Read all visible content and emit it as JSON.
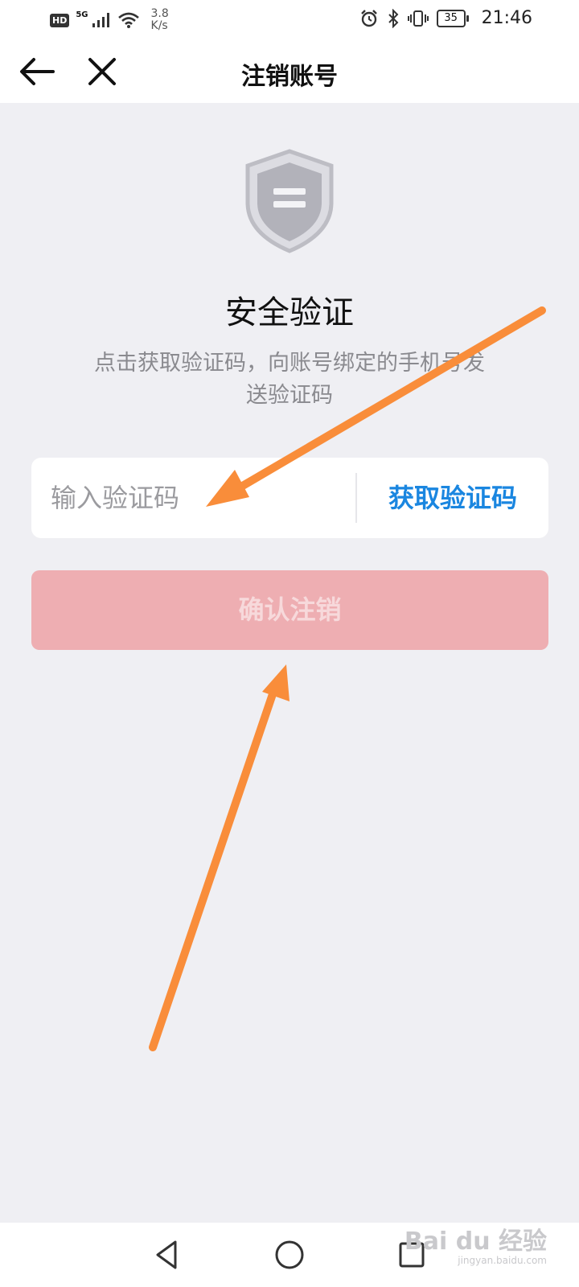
{
  "status_bar": {
    "hd": "HD",
    "network": "5G",
    "speed_value": "3.8",
    "speed_unit": "K/s",
    "battery": "35",
    "time": "21:46"
  },
  "nav": {
    "title": "注销账号"
  },
  "security": {
    "title": "安全验证",
    "description": "点击获取验证码，向账号绑定的手机号发送验证码"
  },
  "code_field": {
    "placeholder": "输入验证码",
    "get_code_label": "获取验证码"
  },
  "confirm_button": {
    "label": "确认注销"
  },
  "watermark": {
    "brand": "Bai du 经验",
    "url": "jingyan.baidu.com"
  },
  "colors": {
    "accent_blue": "#1a86e0",
    "confirm_disabled": "#eeaeb2",
    "annotation_orange": "#f98d3a",
    "background": "#efeff3"
  }
}
